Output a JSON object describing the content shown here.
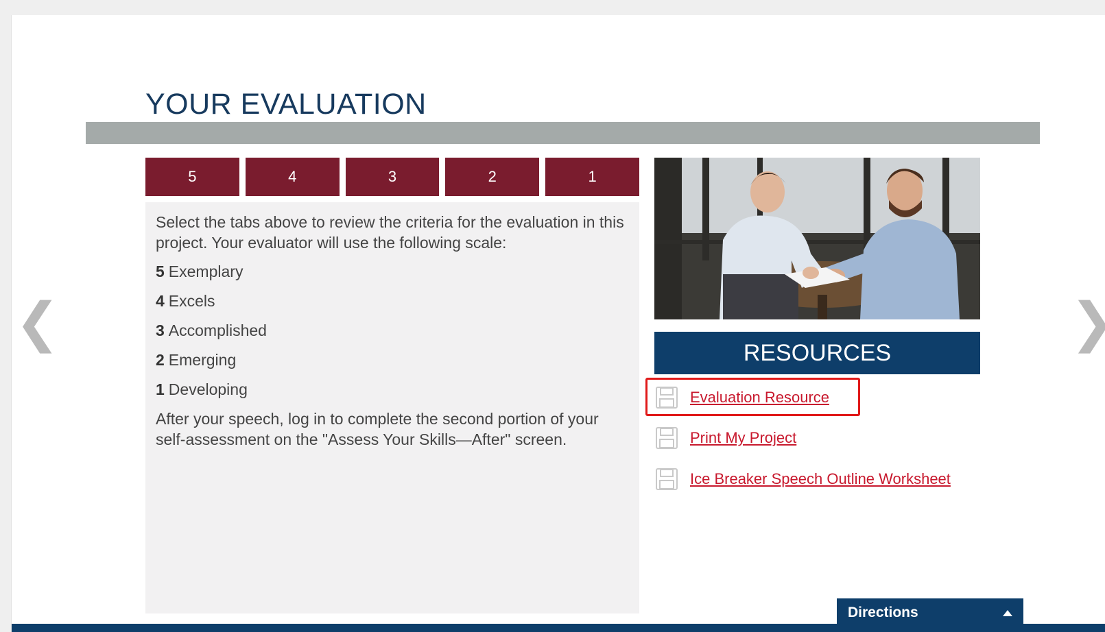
{
  "page": {
    "title": "YOUR EVALUATION"
  },
  "tabs": [
    {
      "label": "5"
    },
    {
      "label": "4"
    },
    {
      "label": "3"
    },
    {
      "label": "2"
    },
    {
      "label": "1"
    }
  ],
  "panel": {
    "intro": "Select the tabs above to review the criteria for the evaluation in this project. Your evaluator will use the following scale:",
    "scale": [
      {
        "num": "5",
        "label": "Exemplary"
      },
      {
        "num": "4",
        "label": "Excels"
      },
      {
        "num": "3",
        "label": "Accomplished"
      },
      {
        "num": "2",
        "label": "Emerging"
      },
      {
        "num": "1",
        "label": "Developing"
      }
    ],
    "outro": "After your speech, log in to complete the second portion of your self-assessment on the \"Assess Your Skills—After\" screen."
  },
  "resources": {
    "header": "RESOURCES",
    "items": [
      {
        "label": "Evaluation Resource",
        "icon": "save-icon"
      },
      {
        "label": "Print My Project",
        "icon": "save-icon"
      },
      {
        "label": "Ice Breaker Speech Outline Worksheet",
        "icon": "save-icon"
      }
    ]
  },
  "nav": {
    "prev_glyph": "❮",
    "next_glyph": "❯"
  },
  "directions": {
    "label": "Directions"
  },
  "colors": {
    "title": "#173a5e",
    "tab": "#7a1c2e",
    "navy": "#0e3e6a",
    "link": "#c8192e",
    "highlight": "#e01919",
    "title_bar": "#a4aaa9"
  }
}
